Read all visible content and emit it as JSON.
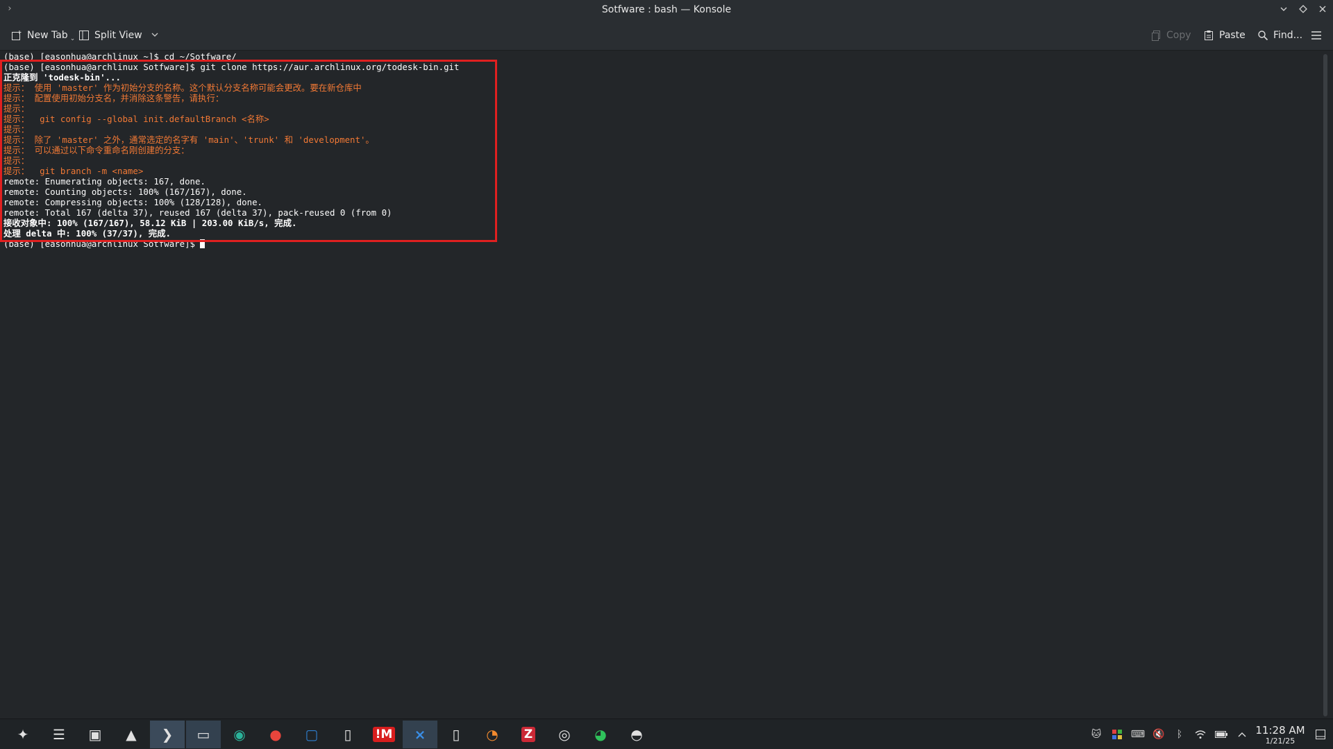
{
  "window": {
    "title": "Sotfware : bash — Konsole"
  },
  "toolbar": {
    "new_tab": "New Tab",
    "split_view": "Split View",
    "copy": "Copy",
    "paste": "Paste",
    "find": "Find..."
  },
  "terminal": {
    "lines": [
      {
        "text": "(base) [easonhua@archlinux ~]$ cd ~/Sotfware/",
        "style": "white"
      },
      {
        "text": "(base) [easonhua@archlinux Sotfware]$ git clone https://aur.archlinux.org/todesk-bin.git",
        "style": "white"
      },
      {
        "text": "正克隆到 'todesk-bin'...",
        "style": "white-bold"
      },
      {
        "text": "提示： 使用 'master' 作为初始分支的名称。这个默认分支名称可能会更改。要在新仓库中",
        "style": "orange"
      },
      {
        "text": "提示： 配置使用初始分支名，并消除这条警告，请执行：",
        "style": "orange"
      },
      {
        "text": "提示：",
        "style": "orange"
      },
      {
        "text": "提示：  git config --global init.defaultBranch <名称>",
        "style": "orange"
      },
      {
        "text": "提示：",
        "style": "orange"
      },
      {
        "text": "提示： 除了 'master' 之外，通常选定的名字有 'main'、'trunk' 和 'development'。",
        "style": "orange"
      },
      {
        "text": "提示： 可以通过以下命令重命名刚创建的分支：",
        "style": "orange"
      },
      {
        "text": "提示：",
        "style": "orange"
      },
      {
        "text": "提示：  git branch -m <name>",
        "style": "orange"
      },
      {
        "text": "remote: Enumerating objects: 167, done.",
        "style": "white"
      },
      {
        "text": "remote: Counting objects: 100% (167/167), done.",
        "style": "white"
      },
      {
        "text": "remote: Compressing objects: 100% (128/128), done.",
        "style": "white"
      },
      {
        "text": "remote: Total 167 (delta 37), reused 167 (delta 37), pack-reused 0 (from 0)",
        "style": "white"
      },
      {
        "text": "接收对象中: 100% (167/167), 58.12 KiB | 203.00 KiB/s, 完成.",
        "style": "white-bold"
      },
      {
        "text": "处理 delta 中: 100% (37/37), 完成.",
        "style": "white-bold"
      },
      {
        "text": "(base) [easonhua@archlinux Sotfware]$ ",
        "style": "white",
        "cursor": true
      }
    ]
  },
  "taskbar": {
    "apps": [
      {
        "name": "app-launcher-icon",
        "glyph": "✦"
      },
      {
        "name": "system-settings-icon",
        "glyph": "☰"
      },
      {
        "name": "discover-store-icon",
        "glyph": "▣"
      },
      {
        "name": "image-viewer-icon",
        "glyph": "▲"
      },
      {
        "name": "konsole-icon",
        "glyph": "❯"
      },
      {
        "name": "file-manager-icon",
        "glyph": "▭"
      },
      {
        "name": "gnome-settings-icon",
        "glyph": "◉"
      },
      {
        "name": "chrome-icon",
        "glyph": "●"
      },
      {
        "name": "virtualbox-icon",
        "glyph": "▢"
      },
      {
        "name": "text-document-icon",
        "glyph": "▯"
      },
      {
        "name": "netease-music-icon",
        "glyph": "!M"
      },
      {
        "name": "vscode-icon",
        "glyph": "⨯"
      },
      {
        "name": "document-icon",
        "glyph": "▯"
      },
      {
        "name": "blender-icon",
        "glyph": "◔"
      },
      {
        "name": "zotero-icon",
        "glyph": "Z"
      },
      {
        "name": "obs-studio-icon",
        "glyph": "◎"
      },
      {
        "name": "wechat-icon",
        "glyph": "◕"
      },
      {
        "name": "qq-icon",
        "glyph": "◓"
      }
    ],
    "clock_time": "11:28 AM",
    "clock_date": "1/21/25"
  },
  "colors": {
    "terminal_bg": "#232629",
    "prompt_text": "#fcfcfc",
    "hint_text": "#f27935",
    "highlight_border": "#e02020"
  }
}
